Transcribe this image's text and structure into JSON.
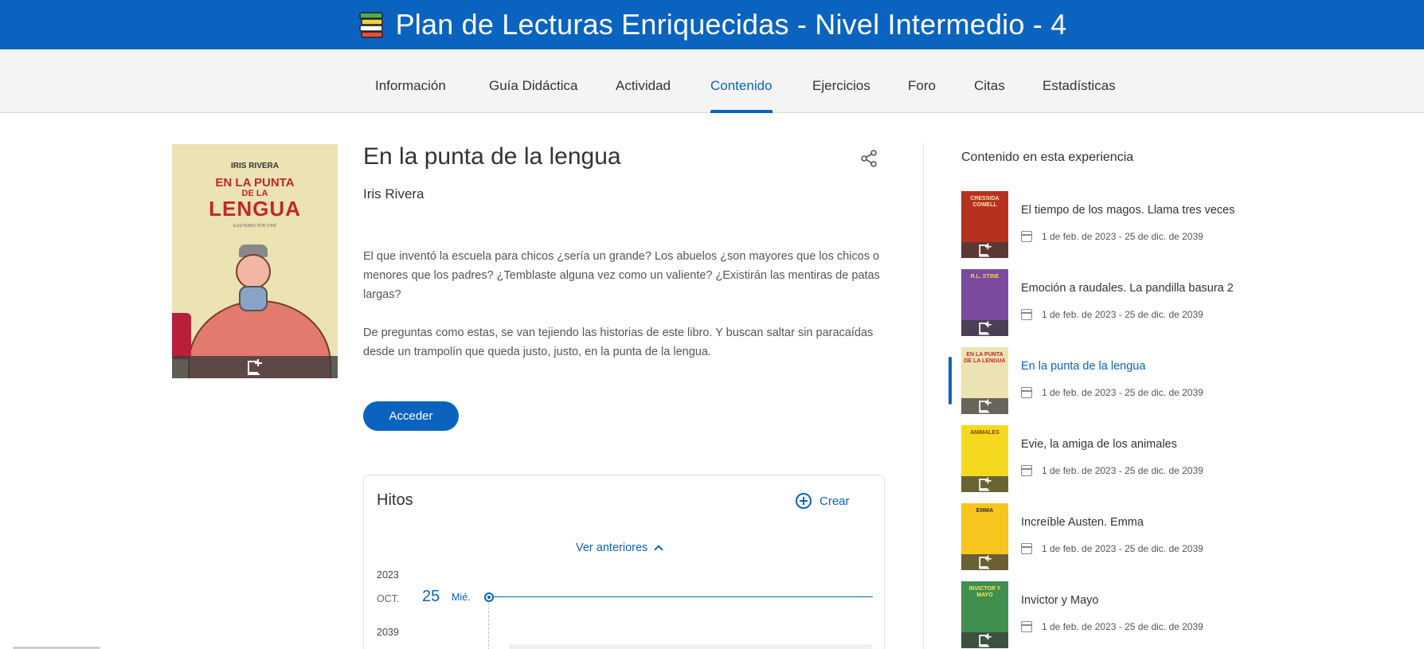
{
  "header": {
    "title": "Plan de Lecturas Enriquecidas - Nivel Intermedio - 4",
    "icon": "books-stack-icon",
    "bg_color": "#0a63bf"
  },
  "tabs": [
    {
      "label": "Información"
    },
    {
      "label": "Guía Didáctica"
    },
    {
      "label": "Actividad"
    },
    {
      "label": "Contenido",
      "active": true
    },
    {
      "label": "Ejercicios"
    },
    {
      "label": "Foro"
    },
    {
      "label": "Citas"
    },
    {
      "label": "Estadísticas"
    }
  ],
  "book": {
    "title": "En la punta de la lengua",
    "author": "Iris Rivera",
    "cover": {
      "author": "IRIS RIVERA",
      "line1": "EN LA PUNTA",
      "line2": "DE LA",
      "line3": "LENGUA",
      "illustrator": "ILUSTRADO POR O'KIF"
    },
    "description": [
      "El que inventó la escuela para chicos ¿sería un grande? Los abuelos ¿son mayores que los chicos o menores que los padres? ¿Temblaste alguna vez como un valiente? ¿Existirán las mentiras de patas largas?",
      "De preguntas como estas, se van tejiendo las historias de este libro. Y buscan saltar sin paracaídas desde un trampolín que queda justo, justo, en la punta de la lengua."
    ],
    "access_label": "Acceder"
  },
  "hitos": {
    "title": "Hitos",
    "create_label": "Crear",
    "see_previous_label": "Ver anteriores",
    "year1": "2023",
    "month": "OCT.",
    "day": "25",
    "weekday": "Mié.",
    "year2": "2039"
  },
  "sidebar": {
    "title": "Contenido en esta experiencia",
    "items": [
      {
        "name": "El tiempo de los magos. Llama tres veces",
        "date": "1 de feb. de 2023 - 25 de dic. de 2039",
        "thumb_color": "#b8311f",
        "thumb_text": "CRESSIDA COWELL",
        "thumb_text_color": "#f8e7b0"
      },
      {
        "name": "Emoción a raudales. La pandilla basura 2",
        "date": "1 de feb. de 2023 - 25 de dic. de 2039",
        "thumb_color": "#7b4aa0",
        "thumb_text": "R.L. STINE",
        "thumb_text_color": "#f4d542"
      },
      {
        "name": "En la punta de la lengua",
        "date": "1 de feb. de 2023 - 25 de dic. de 2039",
        "thumb_color": "#ece3b2",
        "thumb_text": "EN LA PUNTA DE LA LENGUA",
        "thumb_text_color": "#c1272d",
        "active": true
      },
      {
        "name": "Evie, la amiga de los animales",
        "date": "1 de feb. de 2023 - 25 de dic. de 2039",
        "thumb_color": "#f4d920",
        "thumb_text": "ANIMALES",
        "thumb_text_color": "#8a3a12"
      },
      {
        "name": "Increíble Austen. Emma",
        "date": "1 de feb. de 2023 - 25 de dic. de 2039",
        "thumb_color": "#f7c51e",
        "thumb_text": "EMMA",
        "thumb_text_color": "#333333"
      },
      {
        "name": "Invictor y Mayo",
        "date": "1 de feb. de 2023 - 25 de dic. de 2039",
        "thumb_color": "#3f8f4e",
        "thumb_text": "INVICTOR Y MAYO",
        "thumb_text_color": "#ffe45a"
      }
    ]
  }
}
